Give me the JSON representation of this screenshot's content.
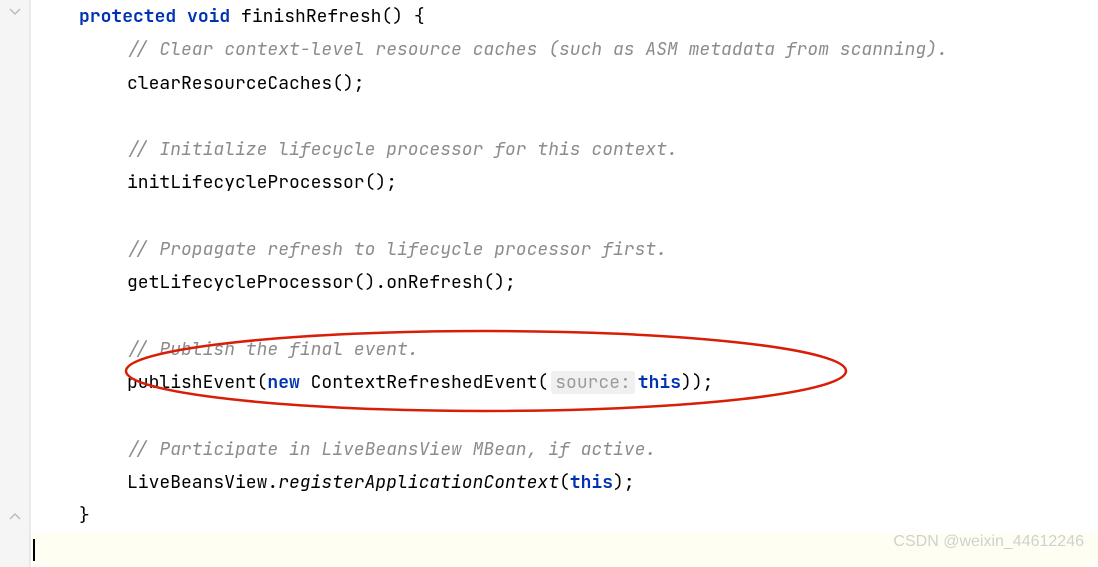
{
  "code": {
    "sig_protected": "protected",
    "sig_void": "void",
    "sig_name": "finishRefresh() {",
    "c_clear": "// Clear context-level resource caches (such as ASM metadata from scanning).",
    "l_clear": "clearResourceCaches();",
    "c_init": "// Initialize lifecycle processor for this context.",
    "l_init": "initLifecycleProcessor();",
    "c_prop": "// Propagate refresh to lifecycle processor first.",
    "l_prop": "getLifecycleProcessor().onRefresh();",
    "c_pub": "// Publish the final event.",
    "l_pub_a": "publishEvent(",
    "l_pub_new": "new",
    "l_pub_b": " ContextRefreshedEvent(",
    "l_pub_hint": "source:",
    "l_pub_this": "this",
    "l_pub_c": "));",
    "c_live": "// Participate in LiveBeansView MBean, if active.",
    "l_live_a": "LiveBeansView.",
    "l_live_b": "registerApplicationContext",
    "l_live_c": "(",
    "l_live_this": "this",
    "l_live_d": ");",
    "close": "}"
  },
  "watermark": "CSDN @weixin_44612246"
}
